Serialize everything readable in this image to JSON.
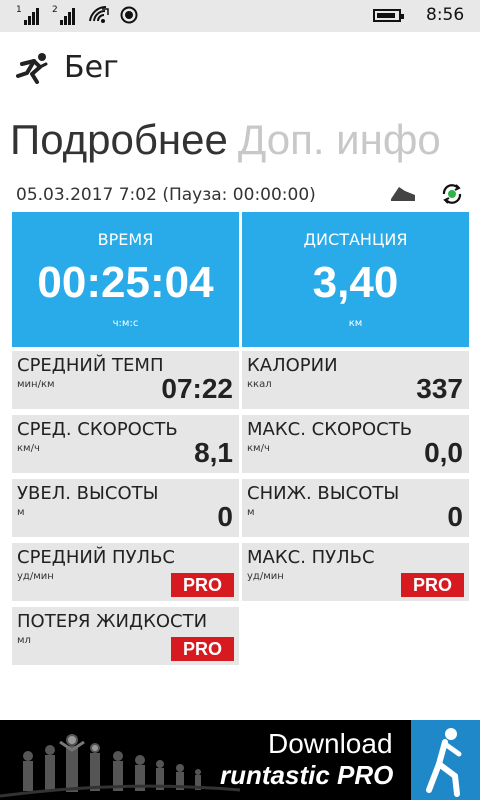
{
  "status_bar": {
    "sim1": "1",
    "sim2": "2",
    "time": "8:56"
  },
  "header": {
    "title": "Бег",
    "icon": "runner-icon"
  },
  "pivot": {
    "active": "Подробнее",
    "inactive": "Доп. инфо"
  },
  "session": {
    "datetime": "05.03.2017 7:02",
    "pause": "(Пауза: 00:00:00)"
  },
  "main_tiles": [
    {
      "label": "ВРЕМЯ",
      "value": "00:25:04",
      "unit": "ч:м:с"
    },
    {
      "label": "ДИСТАНЦИЯ",
      "value": "3,40",
      "unit": "км"
    }
  ],
  "stats": [
    {
      "label": "СРЕДНИЙ ТЕМП",
      "unit": "мин/км",
      "value": "07:22"
    },
    {
      "label": "КАЛОРИИ",
      "unit": "ккал",
      "value": "337"
    },
    {
      "label": "СРЕД. СКОРОСТЬ",
      "unit": "км/ч",
      "value": "8,1"
    },
    {
      "label": "МАКС. СКОРОСТЬ",
      "unit": "км/ч",
      "value": "0,0"
    },
    {
      "label": "УВЕЛ. ВЫСОТЫ",
      "unit": "м",
      "value": "0"
    },
    {
      "label": "СНИЖ. ВЫСОТЫ",
      "unit": "м",
      "value": "0"
    },
    {
      "label": "СРЕДНИЙ ПУЛЬС",
      "unit": "уд/мин",
      "badge": "PRO"
    },
    {
      "label": "МАКС. ПУЛЬС",
      "unit": "уд/мин",
      "badge": "PRO"
    },
    {
      "label": "ПОТЕРЯ ЖИДКОСТИ",
      "unit": "мл",
      "badge": "PRO"
    }
  ],
  "banner": {
    "line1": "Download",
    "line2": "runtastic PRO"
  },
  "colors": {
    "accent_blue": "#29abe9",
    "pro_red": "#d71920",
    "tile_gray": "#e6e6e6"
  }
}
